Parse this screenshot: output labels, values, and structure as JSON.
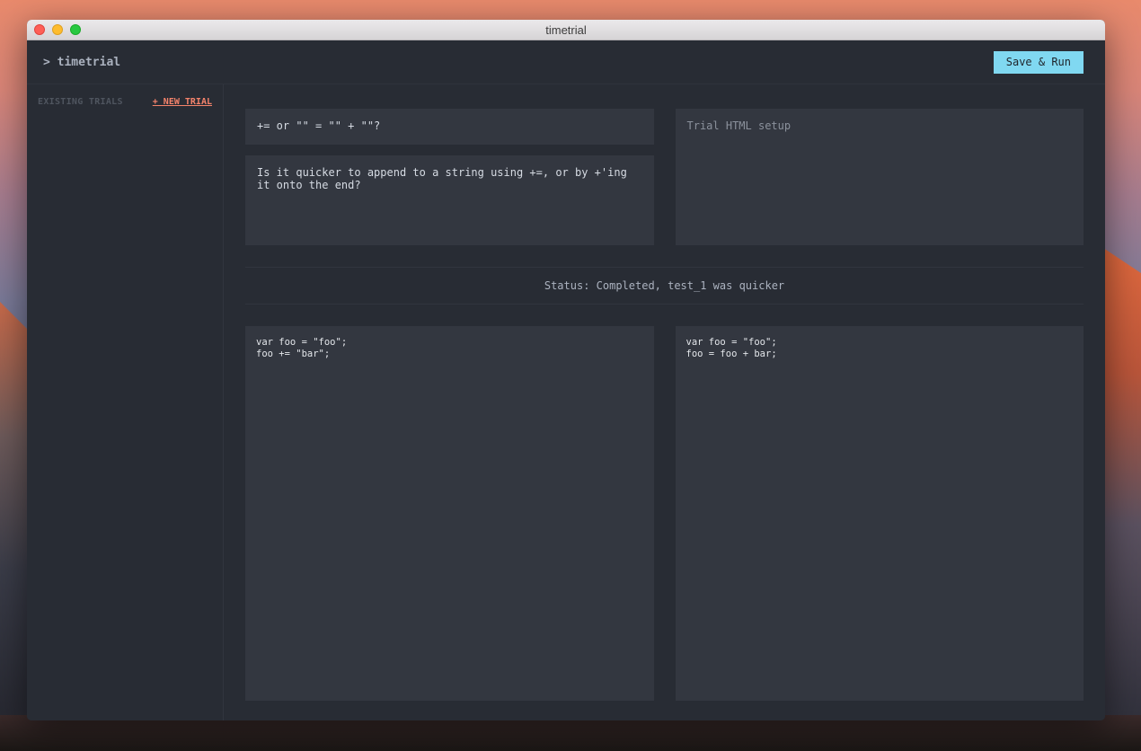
{
  "window": {
    "title": "timetrial"
  },
  "header": {
    "brand": "> timetrial",
    "run_label": "Save & Run"
  },
  "sidebar": {
    "label": "EXISTING TRIALS",
    "new_trial_label": "+ NEW TRIAL"
  },
  "trial": {
    "title": "+= or \"\" = \"\" + \"\"?",
    "description": "Is it quicker to append to a string using +=, or by +'ing\nit onto the end?",
    "setup_placeholder": "Trial HTML setup"
  },
  "status": {
    "text": "Status: Completed, test_1 was quicker"
  },
  "tests": [
    {
      "code": "var foo = \"foo\";\nfoo += \"bar\";"
    },
    {
      "code": "var foo = \"foo\";\nfoo = foo + bar;"
    }
  ],
  "colors": {
    "accent": "#80d8f1",
    "link": "#f4836b",
    "background": "#282c34",
    "panel": "#333740"
  }
}
